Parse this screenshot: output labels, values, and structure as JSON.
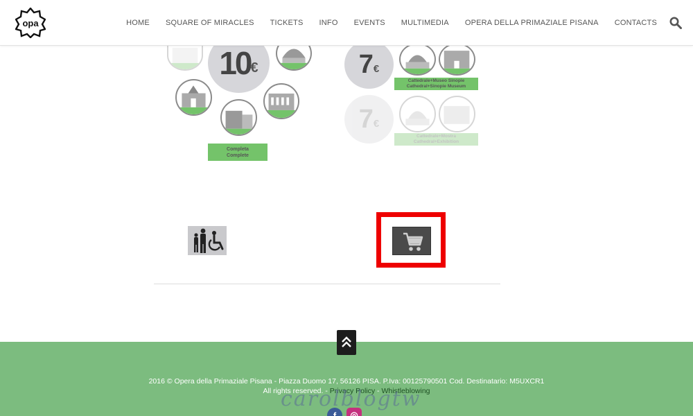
{
  "nav": {
    "items": [
      "HOME",
      "SQUARE OF MIRACLES",
      "TICKETS",
      "INFO",
      "EVENTS",
      "MULTIMEDIA",
      "OPERA DELLA PRIMAZIALE PISANA",
      "CONTACTS"
    ],
    "logo_text": "opa",
    "search_icon": "search-icon"
  },
  "tickets": {
    "complete": {
      "price": "10",
      "currency": "€",
      "tag_line1": "Completa",
      "tag_line2": "Complete"
    },
    "cathedral_museum": {
      "price": "7",
      "currency": "€",
      "tag_line1": "Cattedrale+Museo Sinopie",
      "tag_line2": "Cathedral+Sinopie Museum"
    },
    "cathedral_exhibition": {
      "price": "7",
      "currency": "€",
      "tag_line1": "Cattedrale+Mostra",
      "tag_line2": "Cathedral+Exhibition"
    }
  },
  "buttons": {
    "family_icon": "family-accessibility-icon",
    "cart_icon": "shopping-cart-icon",
    "back_to_top_icon": "double-chevron-up-icon"
  },
  "footer": {
    "line1": "2016 © Opera della Primaziale Pisana - Piazza Duomo 17, 56126 PISA. P.Iva: 00125790501 Cod. Destinatario: M5UXCR1",
    "rights": "All rights reserved. - ",
    "privacy": "Privacy Policy",
    "sep": " - ",
    "whistleblowing": "Whistleblowing",
    "watermark": "carolblogtw",
    "facebook": "f",
    "instagram": "◎"
  },
  "colors": {
    "accent_green": "#7cbc7f",
    "tag_green": "#74c36a",
    "highlight_red": "#ee0000"
  }
}
